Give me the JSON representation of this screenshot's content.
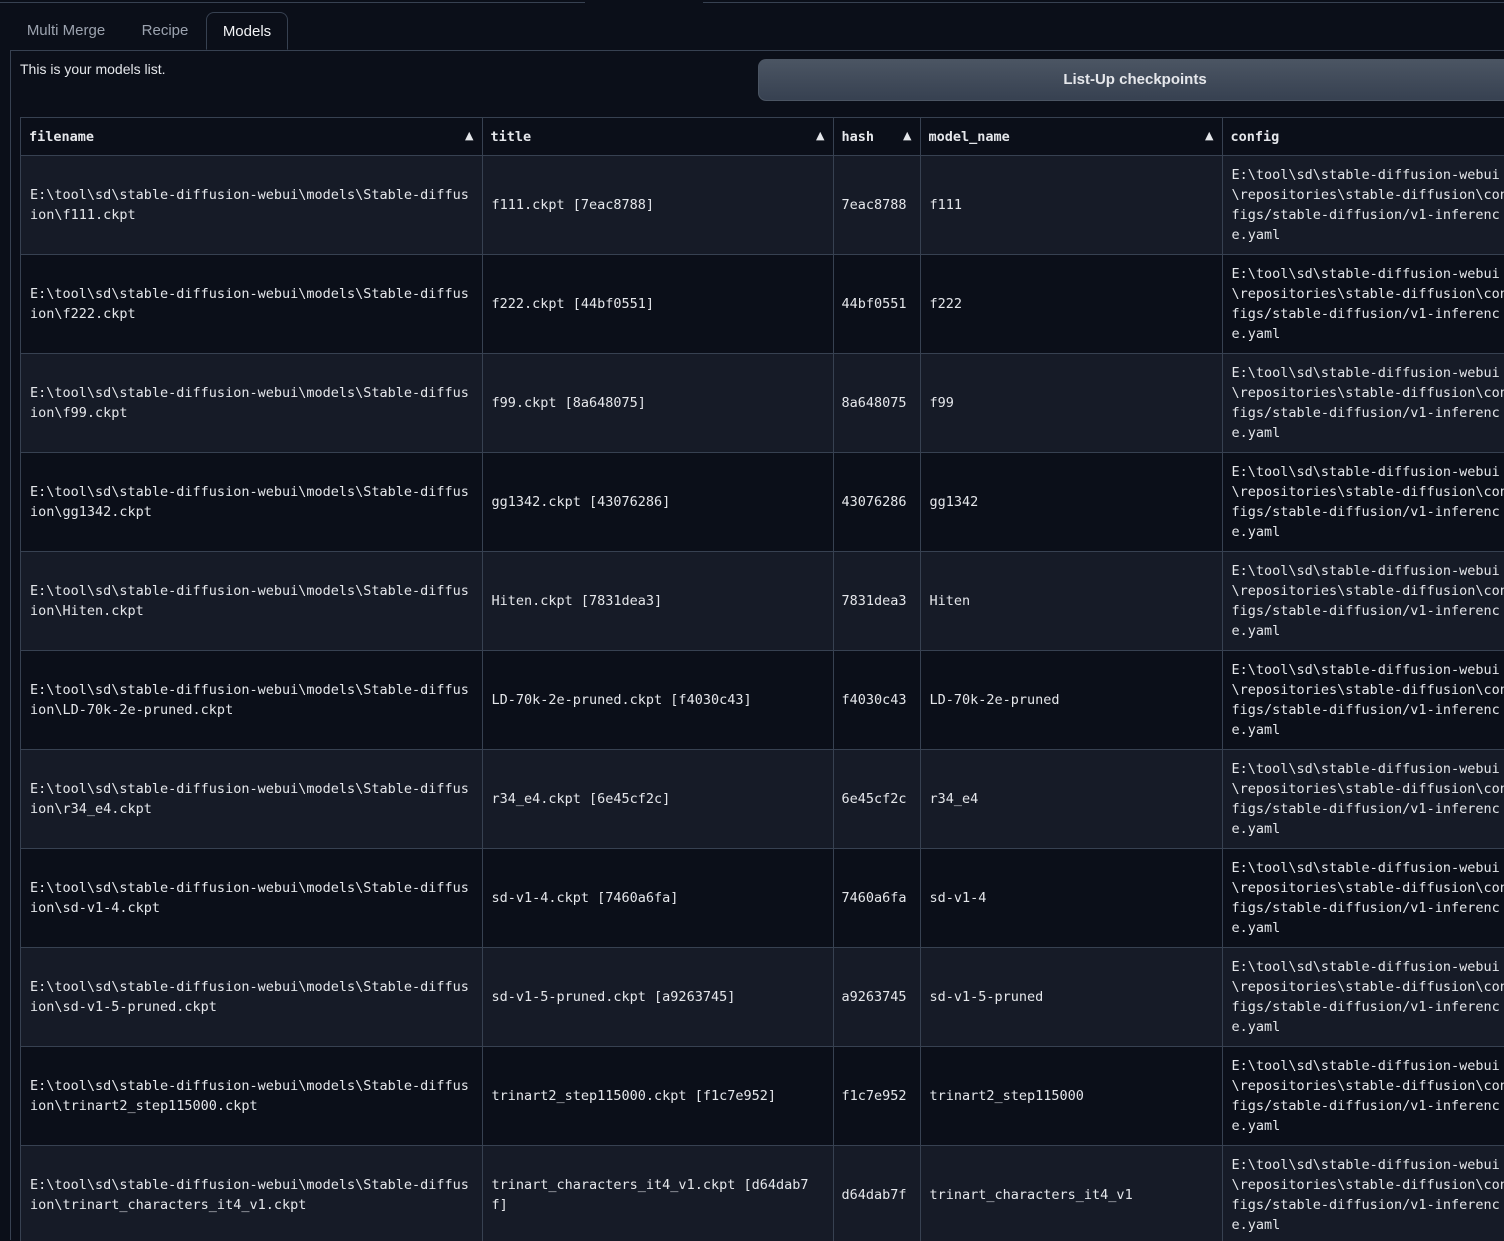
{
  "tabs": [
    {
      "label": "Multi Merge"
    },
    {
      "label": "Recipe"
    },
    {
      "label": "Models"
    }
  ],
  "intro_text": "This is your models list.",
  "list_button_label": "List-Up checkpoints",
  "table": {
    "columns": [
      "filename",
      "title",
      "hash",
      "model_name",
      "config"
    ],
    "sort_indicator": "▲",
    "rows": [
      {
        "filename": "E:\\tool\\sd\\stable-diffusion-webui\\models\\Stable-diffusion\\f111.ckpt",
        "title": "f111.ckpt [7eac8788]",
        "hash": "7eac8788",
        "model_name": "f111",
        "config": "E:\\tool\\sd\\stable-diffusion-webui\\repositories\\stable-diffusion\\configs/stable-diffusion/v1-inference.yaml"
      },
      {
        "filename": "E:\\tool\\sd\\stable-diffusion-webui\\models\\Stable-diffusion\\f222.ckpt",
        "title": "f222.ckpt [44bf0551]",
        "hash": "44bf0551",
        "model_name": "f222",
        "config": "E:\\tool\\sd\\stable-diffusion-webui\\repositories\\stable-diffusion\\configs/stable-diffusion/v1-inference.yaml"
      },
      {
        "filename": "E:\\tool\\sd\\stable-diffusion-webui\\models\\Stable-diffusion\\f99.ckpt",
        "title": "f99.ckpt [8a648075]",
        "hash": "8a648075",
        "model_name": "f99",
        "config": "E:\\tool\\sd\\stable-diffusion-webui\\repositories\\stable-diffusion\\configs/stable-diffusion/v1-inference.yaml"
      },
      {
        "filename": "E:\\tool\\sd\\stable-diffusion-webui\\models\\Stable-diffusion\\gg1342.ckpt",
        "title": "gg1342.ckpt [43076286]",
        "hash": "43076286",
        "model_name": "gg1342",
        "config": "E:\\tool\\sd\\stable-diffusion-webui\\repositories\\stable-diffusion\\configs/stable-diffusion/v1-inference.yaml"
      },
      {
        "filename": "E:\\tool\\sd\\stable-diffusion-webui\\models\\Stable-diffusion\\Hiten.ckpt",
        "title": "Hiten.ckpt [7831dea3]",
        "hash": "7831dea3",
        "model_name": "Hiten",
        "config": "E:\\tool\\sd\\stable-diffusion-webui\\repositories\\stable-diffusion\\configs/stable-diffusion/v1-inference.yaml"
      },
      {
        "filename": "E:\\tool\\sd\\stable-diffusion-webui\\models\\Stable-diffusion\\LD-70k-2e-pruned.ckpt",
        "title": "LD-70k-2e-pruned.ckpt [f4030c43]",
        "hash": "f4030c43",
        "model_name": "LD-70k-2e-pruned",
        "config": "E:\\tool\\sd\\stable-diffusion-webui\\repositories\\stable-diffusion\\configs/stable-diffusion/v1-inference.yaml"
      },
      {
        "filename": "E:\\tool\\sd\\stable-diffusion-webui\\models\\Stable-diffusion\\r34_e4.ckpt",
        "title": "r34_e4.ckpt [6e45cf2c]",
        "hash": "6e45cf2c",
        "model_name": "r34_e4",
        "config": "E:\\tool\\sd\\stable-diffusion-webui\\repositories\\stable-diffusion\\configs/stable-diffusion/v1-inference.yaml"
      },
      {
        "filename": "E:\\tool\\sd\\stable-diffusion-webui\\models\\Stable-diffusion\\sd-v1-4.ckpt",
        "title": "sd-v1-4.ckpt [7460a6fa]",
        "hash": "7460a6fa",
        "model_name": "sd-v1-4",
        "config": "E:\\tool\\sd\\stable-diffusion-webui\\repositories\\stable-diffusion\\configs/stable-diffusion/v1-inference.yaml"
      },
      {
        "filename": "E:\\tool\\sd\\stable-diffusion-webui\\models\\Stable-diffusion\\sd-v1-5-pruned.ckpt",
        "title": "sd-v1-5-pruned.ckpt [a9263745]",
        "hash": "a9263745",
        "model_name": "sd-v1-5-pruned",
        "config": "E:\\tool\\sd\\stable-diffusion-webui\\repositories\\stable-diffusion\\configs/stable-diffusion/v1-inference.yaml"
      },
      {
        "filename": "E:\\tool\\sd\\stable-diffusion-webui\\models\\Stable-diffusion\\trinart2_step115000.ckpt",
        "title": "trinart2_step115000.ckpt [f1c7e952]",
        "hash": "f1c7e952",
        "model_name": "trinart2_step115000",
        "config": "E:\\tool\\sd\\stable-diffusion-webui\\repositories\\stable-diffusion\\configs/stable-diffusion/v1-inference.yaml"
      },
      {
        "filename": "E:\\tool\\sd\\stable-diffusion-webui\\models\\Stable-diffusion\\trinart_characters_it4_v1.ckpt",
        "title": "trinart_characters_it4_v1.ckpt [d64dab7f]",
        "hash": "d64dab7f",
        "model_name": "trinart_characters_it4_v1",
        "config": "E:\\tool\\sd\\stable-diffusion-webui\\repositories\\stable-diffusion\\configs/stable-diffusion/v1-inference.yaml"
      }
    ]
  }
}
